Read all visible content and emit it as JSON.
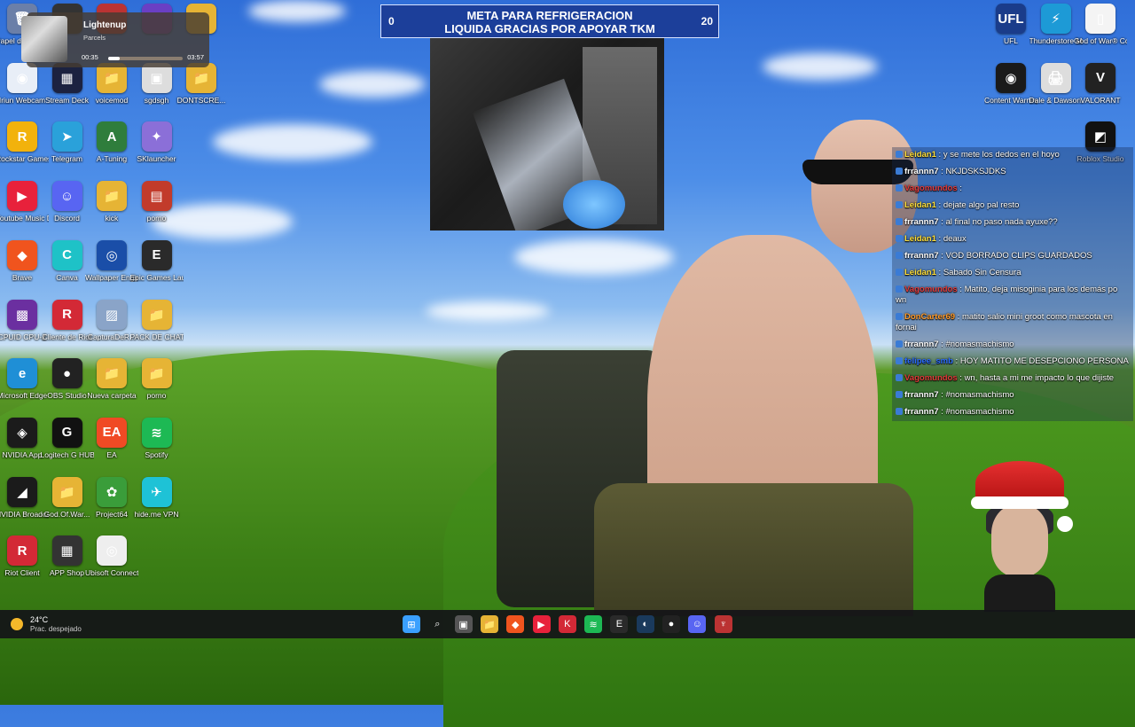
{
  "desktop_icons": [
    {
      "label": "Papel de recicl...",
      "color": "#6b7fa8",
      "glyph": "🗑",
      "col": 0,
      "row": 0
    },
    {
      "label": "",
      "color": "#333",
      "glyph": "",
      "col": 1,
      "row": 0
    },
    {
      "label": "",
      "color": "#b33",
      "glyph": "",
      "col": 2,
      "row": 0
    },
    {
      "label": "",
      "color": "#6a3fc4",
      "glyph": "",
      "col": 3,
      "row": 0
    },
    {
      "label": "",
      "color": "#e6b435",
      "glyph": "",
      "col": 4,
      "row": 0
    },
    {
      "label": "Iriun Webcam",
      "color": "#e8eef7",
      "glyph": "◉",
      "col": 0,
      "row": 1
    },
    {
      "label": "Stream Deck",
      "color": "#1c2240",
      "glyph": "▦",
      "col": 1,
      "row": 1
    },
    {
      "label": "voicemod",
      "color": "#e6b435",
      "glyph": "📁",
      "col": 2,
      "row": 1
    },
    {
      "label": "sgdsgh",
      "color": "#ddd",
      "glyph": "▣",
      "col": 3,
      "row": 1
    },
    {
      "label": "DONTSCRE...",
      "color": "#e6b435",
      "glyph": "📁",
      "col": 4,
      "row": 1
    },
    {
      "label": "Rockstar Games ...",
      "color": "#f2b20c",
      "glyph": "R",
      "col": 0,
      "row": 2
    },
    {
      "label": "Telegram",
      "color": "#2aa1da",
      "glyph": "➤",
      "col": 1,
      "row": 2
    },
    {
      "label": "A-Tuning",
      "color": "#2f7d3c",
      "glyph": "A",
      "col": 2,
      "row": 2
    },
    {
      "label": "SKlauncher",
      "color": "#8b6fd8",
      "glyph": "✦",
      "col": 3,
      "row": 2
    },
    {
      "label": "Youtube Music Des...",
      "color": "#e8213b",
      "glyph": "▶",
      "col": 0,
      "row": 3
    },
    {
      "label": "Discord",
      "color": "#5865f2",
      "glyph": "☺",
      "col": 1,
      "row": 3
    },
    {
      "label": "kick",
      "color": "#e6b435",
      "glyph": "📁",
      "col": 2,
      "row": 3
    },
    {
      "label": "porno",
      "color": "#c23b2b",
      "glyph": "▤",
      "col": 3,
      "row": 3
    },
    {
      "label": "Brave",
      "color": "#f0541e",
      "glyph": "◆",
      "col": 0,
      "row": 4
    },
    {
      "label": "Canva",
      "color": "#1ec2c7",
      "glyph": "C",
      "col": 1,
      "row": 4
    },
    {
      "label": "Wallpaper Engine",
      "color": "#1a4ea8",
      "glyph": "◎",
      "col": 2,
      "row": 4
    },
    {
      "label": "Epic Games Launcher",
      "color": "#2a2a2a",
      "glyph": "E",
      "col": 3,
      "row": 4
    },
    {
      "label": "CPUID CPU-Z",
      "color": "#6b2fa0",
      "glyph": "▩",
      "col": 0,
      "row": 5
    },
    {
      "label": "Cliente de Riot",
      "color": "#d32936",
      "glyph": "R",
      "col": 1,
      "row": 5
    },
    {
      "label": "CapturaDeR...",
      "color": "#8aa4c8",
      "glyph": "▨",
      "col": 2,
      "row": 5
    },
    {
      "label": "PACK DE CHAT",
      "color": "#e6b435",
      "glyph": "📁",
      "col": 3,
      "row": 5
    },
    {
      "label": "Microsoft Edge",
      "color": "#1f8fd6",
      "glyph": "e",
      "col": 0,
      "row": 6
    },
    {
      "label": "OBS Studio",
      "color": "#222",
      "glyph": "●",
      "col": 1,
      "row": 6
    },
    {
      "label": "Nueva carpeta",
      "color": "#e6b435",
      "glyph": "📁",
      "col": 2,
      "row": 6
    },
    {
      "label": "porno",
      "color": "#e6b435",
      "glyph": "📁",
      "col": 3,
      "row": 6
    },
    {
      "label": "NVIDIA App",
      "color": "#1b1b1b",
      "glyph": "◈",
      "col": 0,
      "row": 7
    },
    {
      "label": "Logitech G HUB",
      "color": "#111",
      "glyph": "G",
      "col": 1,
      "row": 7
    },
    {
      "label": "EA",
      "color": "#f04a24",
      "glyph": "EA",
      "col": 2,
      "row": 7
    },
    {
      "label": "Spotify",
      "color": "#1db954",
      "glyph": "≋",
      "col": 3,
      "row": 7
    },
    {
      "label": "NVIDIA Broadcast",
      "color": "#1b1b1b",
      "glyph": "◢",
      "col": 0,
      "row": 8
    },
    {
      "label": "God.Of.War...",
      "color": "#e6b435",
      "glyph": "📁",
      "col": 1,
      "row": 8
    },
    {
      "label": "Project64",
      "color": "#3a9d3a",
      "glyph": "✿",
      "col": 2,
      "row": 8
    },
    {
      "label": "hide.me VPN",
      "color": "#1ec2d6",
      "glyph": "✈",
      "col": 3,
      "row": 8
    },
    {
      "label": "Riot Client",
      "color": "#d32936",
      "glyph": "R",
      "col": 0,
      "row": 9
    },
    {
      "label": "APP Shop",
      "color": "#333",
      "glyph": "▦",
      "col": 1,
      "row": 9
    },
    {
      "label": "Ubisoft Connect",
      "color": "#eee",
      "glyph": "◎",
      "col": 2,
      "row": 9
    }
  ],
  "right_icons": [
    {
      "label": "UFL",
      "color": "#1a3c8a",
      "glyph": "UFL",
      "col": 0,
      "row": 0
    },
    {
      "label": "Thunderstore Mod Mana...",
      "color": "#1d9ad6",
      "glyph": "⚡",
      "col": 1,
      "row": 0
    },
    {
      "label": "God of War® Collection",
      "color": "#f4f4f4",
      "glyph": "▯",
      "col": 2,
      "row": 0
    },
    {
      "label": "Content Warning",
      "color": "#1a1a1a",
      "glyph": "◉",
      "col": 0,
      "row": 1
    },
    {
      "label": "Dale & Dawson...",
      "color": "#ddd",
      "glyph": "🖨",
      "col": 1,
      "row": 1
    },
    {
      "label": "VALORANT",
      "color": "#222",
      "glyph": "V",
      "col": 2,
      "row": 1
    },
    {
      "label": "Roblox Studio",
      "color": "#111",
      "glyph": "◩",
      "col": 2,
      "row": 2
    }
  ],
  "media_flyout": {
    "title": "Lightenup",
    "artist": "Parcels",
    "elapsed": "00:35",
    "total": "03:57",
    "progress": 0.15
  },
  "goal_bar": {
    "current": "0",
    "target": "20",
    "line1": "META PARA REFRIGERACION",
    "line2": "LIQUIDA GRACIAS POR APOYAR TKM"
  },
  "chat": [
    {
      "user": "Leidan1",
      "color": "#ffdf3a",
      "text": ": y se mete los dedos en el hoyo"
    },
    {
      "user": "frrannn7",
      "color": "#ffffff",
      "text": ": NKJDSKSJDKS"
    },
    {
      "user": "Vagomundos",
      "color": "#e23a3a",
      "text": ": "
    },
    {
      "user": "Leidan1",
      "color": "#ffdf3a",
      "text": ": dejate algo pal resto"
    },
    {
      "user": "frrannn7",
      "color": "#ffffff",
      "text": ": al final no paso nada ayuxe??"
    },
    {
      "user": "Leidan1",
      "color": "#ffdf3a",
      "text": ": deaux"
    },
    {
      "user": "frrannn7",
      "color": "#ffffff",
      "text": ": VOD BORRADO CLIPS GUARDADOS"
    },
    {
      "user": "Leidan1",
      "color": "#ffdf3a",
      "text": ": Sabado Sin Censura"
    },
    {
      "user": "Vagomundos",
      "color": "#e23a3a",
      "text": ": Matito, deja misoginia para los demás po wn"
    },
    {
      "user": "DonCarter69",
      "color": "#ff9a2a",
      "text": ": matito salio mini groot como mascota en fornai"
    },
    {
      "user": "frrannn7",
      "color": "#ffffff",
      "text": ": #nomasmachismo"
    },
    {
      "user": "felipee_smb",
      "color": "#2a6bff",
      "text": ": HOY MATITO ME DESEPCIONO PERSONA"
    },
    {
      "user": "Vagomundos",
      "color": "#e23a3a",
      "text": ": wn, hasta a mi me impacto lo que dijiste"
    },
    {
      "user": "frrannn7",
      "color": "#ffffff",
      "text": ": #nomasmachismo"
    },
    {
      "user": "frrannn7",
      "color": "#ffffff",
      "text": ": #nomasmachismo"
    }
  ],
  "weather": {
    "temp": "24°C",
    "condition": "Prac. despejado"
  },
  "taskbar_icons": [
    {
      "name": "start-icon",
      "color": "#3aa0ff",
      "glyph": "⊞"
    },
    {
      "name": "search-icon",
      "color": "transparent",
      "glyph": "⌕"
    },
    {
      "name": "task-view-icon",
      "color": "#555",
      "glyph": "▣"
    },
    {
      "name": "file-explorer-icon",
      "color": "#e6b435",
      "glyph": "📁"
    },
    {
      "name": "brave-icon",
      "color": "#f0541e",
      "glyph": "◆"
    },
    {
      "name": "youtube-music-icon",
      "color": "#e8213b",
      "glyph": "▶"
    },
    {
      "name": "kick-icon",
      "color": "#d32936",
      "glyph": "K"
    },
    {
      "name": "spotify-icon",
      "color": "#1db954",
      "glyph": "≋"
    },
    {
      "name": "epic-games-icon",
      "color": "#2a2a2a",
      "glyph": "E"
    },
    {
      "name": "steam-icon",
      "color": "#1a3a5c",
      "glyph": "◐"
    },
    {
      "name": "obs-icon",
      "color": "#222",
      "glyph": "●"
    },
    {
      "name": "discord-icon",
      "color": "#5865f2",
      "glyph": "☺"
    },
    {
      "name": "app-icon",
      "color": "#b33",
      "glyph": "♆"
    }
  ]
}
